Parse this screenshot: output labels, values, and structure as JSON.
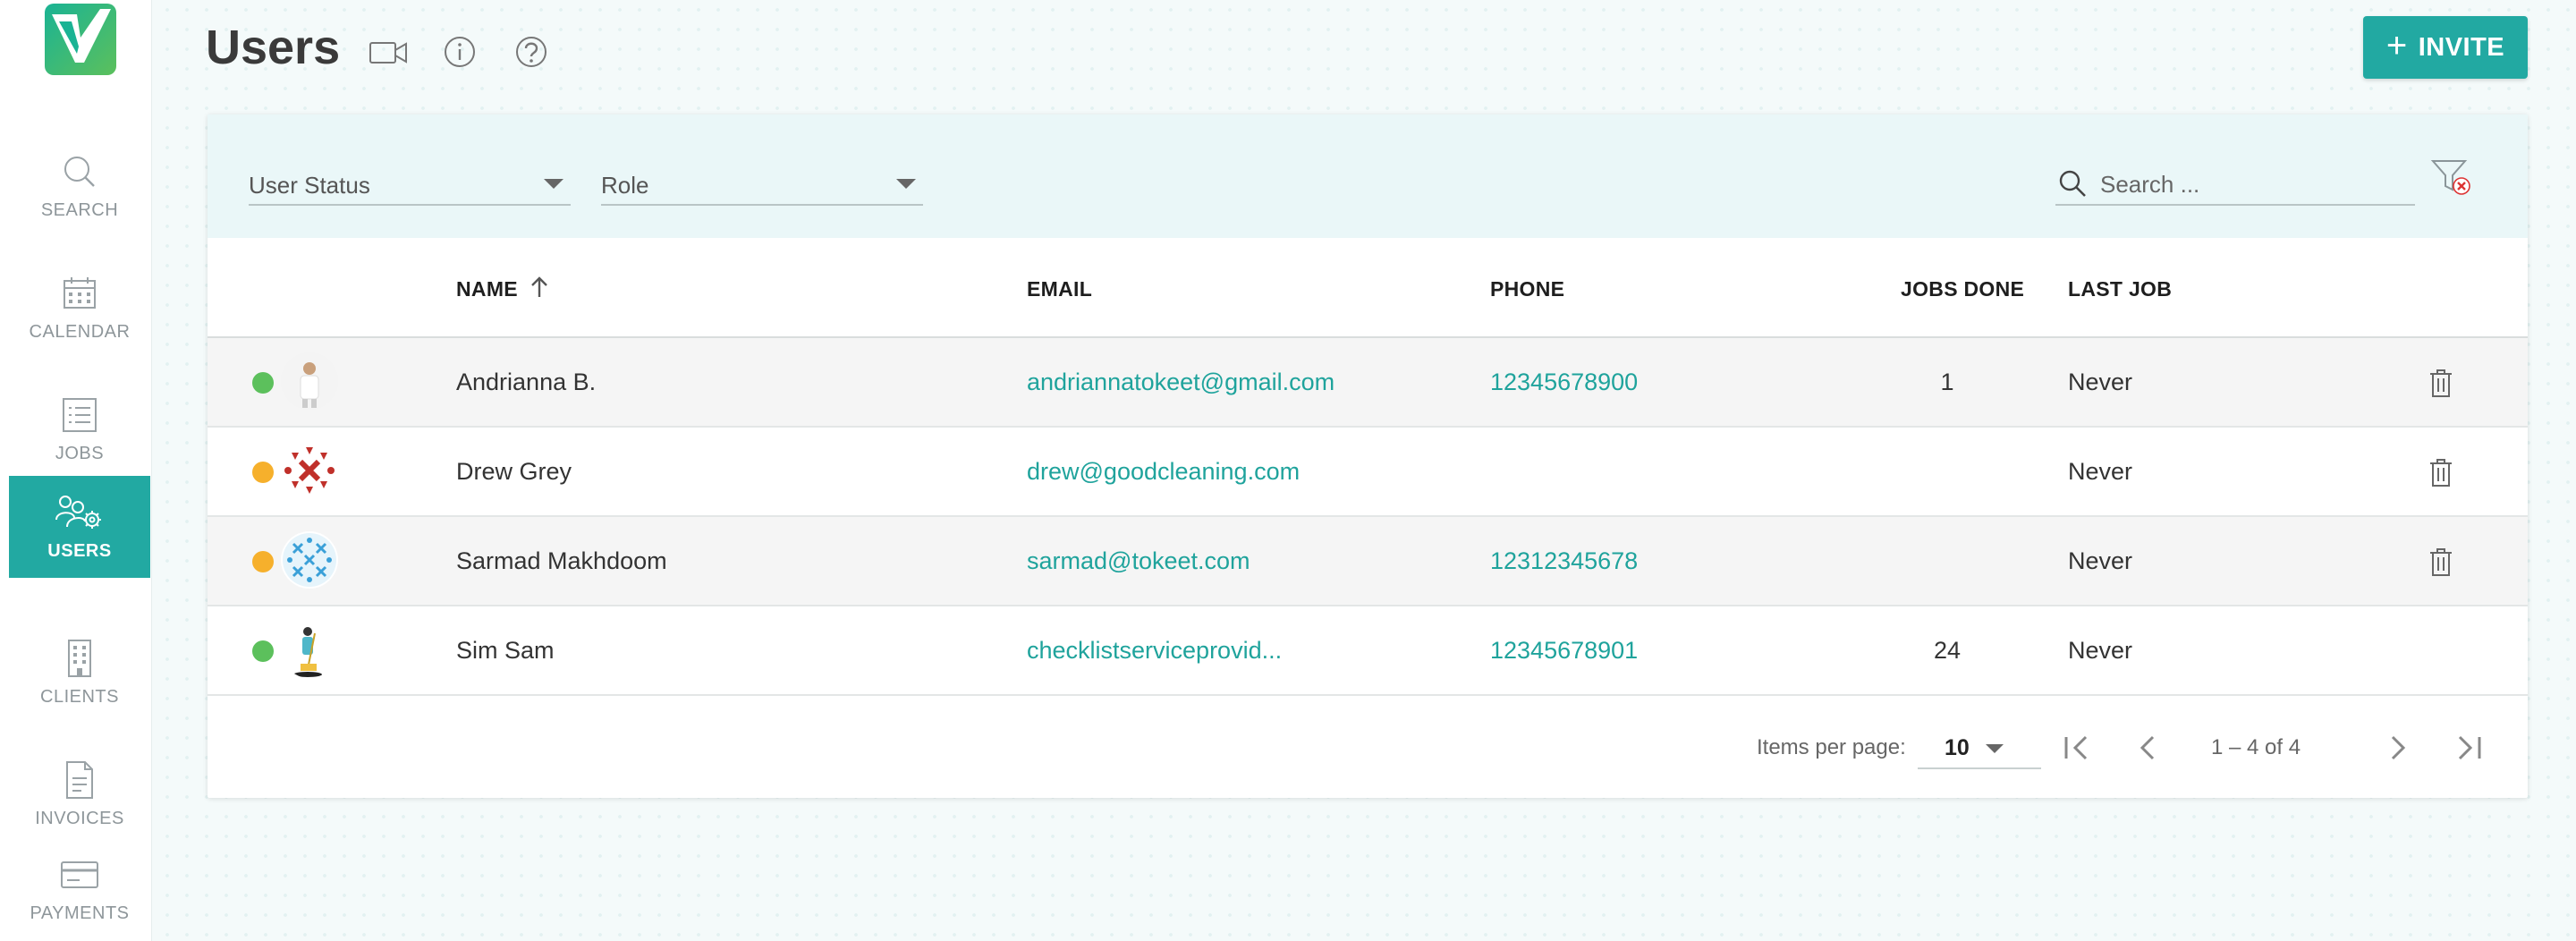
{
  "sidebar": {
    "logo_alt": "",
    "items": [
      {
        "label": "SEARCH",
        "icon": "search-icon"
      },
      {
        "label": "CALENDAR",
        "icon": "calendar-icon"
      },
      {
        "label": "JOBS",
        "icon": "list-icon"
      },
      {
        "label": "USERS",
        "icon": "users-gear-icon",
        "active": true
      },
      {
        "label": "CLIENTS",
        "icon": "building-icon"
      },
      {
        "label": "INVOICES",
        "icon": "invoice-icon"
      },
      {
        "label": "PAYMENTS",
        "icon": "credit-card-icon"
      }
    ]
  },
  "header": {
    "title": "Users",
    "invite_label": "INVITE"
  },
  "filters": {
    "user_status": "User Status",
    "role": "Role",
    "search_placeholder": "Search ..."
  },
  "table": {
    "columns": {
      "name": "NAME",
      "email": "EMAIL",
      "phone": "PHONE",
      "jobs_done": "JOBS DONE",
      "last_job": "LAST JOB"
    },
    "rows": [
      {
        "status": "green",
        "name": "Andrianna B.",
        "email": "andriannatokeet@gmail.com",
        "phone": "12345678900",
        "jobs_done": "1",
        "last_job": "Never",
        "deletable": true
      },
      {
        "status": "orange",
        "name": "Drew Grey",
        "email": "drew@goodcleaning.com",
        "phone": "",
        "jobs_done": "",
        "last_job": "Never",
        "deletable": true
      },
      {
        "status": "orange",
        "name": "Sarmad Makhdoom",
        "email": "sarmad@tokeet.com",
        "phone": "12312345678",
        "jobs_done": "",
        "last_job": "Never",
        "deletable": true
      },
      {
        "status": "green",
        "name": "Sim Sam",
        "email": "checklistserviceprovid...",
        "phone": "12345678901",
        "jobs_done": "24",
        "last_job": "Never",
        "deletable": false
      }
    ]
  },
  "paginator": {
    "items_per_page_label": "Items per page:",
    "page_size": "10",
    "range": "1 – 4 of 4"
  },
  "colors": {
    "accent": "#22a9a2",
    "status_green": "#5cc05c",
    "status_orange": "#f6b02c"
  }
}
